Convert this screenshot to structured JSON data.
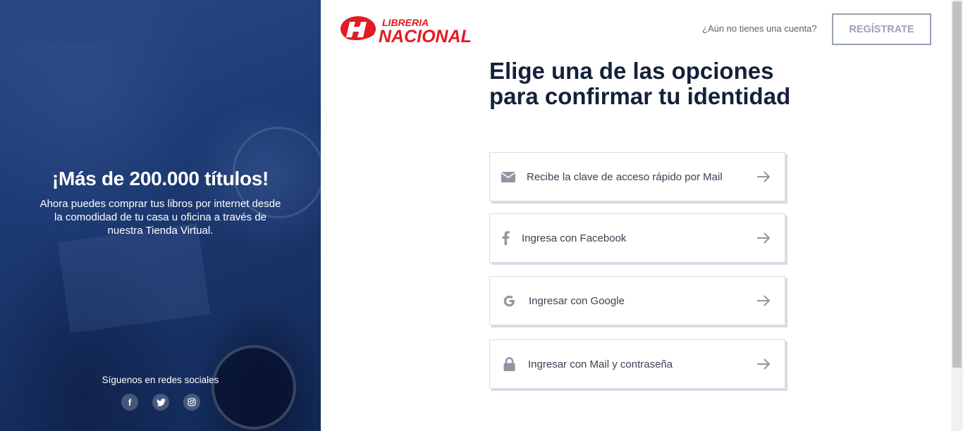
{
  "left_panel": {
    "headline": "¡Más de 200.000 títulos!",
    "description": "Ahora puedes comprar tus libros por internet desde la comodidad de tu casa u oficina a través de nuestra Tienda Virtual.",
    "social_label": "Síguenos en redes sociales",
    "social": [
      {
        "icon": "facebook-icon",
        "glyph": "f"
      },
      {
        "icon": "twitter-icon",
        "glyph": ""
      },
      {
        "icon": "instagram-icon",
        "glyph": ""
      }
    ],
    "colors": {
      "overlay": "#1d3a74"
    }
  },
  "header": {
    "logo_top": "LIBRERIA",
    "logo_bottom": "NACIONAL",
    "logo_color": "#e31b23",
    "question": "¿Aún no tienes una cuenta?",
    "register_label": "REGÍSTRATE"
  },
  "main": {
    "title": "Elige una de las opciones para confirmar tu identidad",
    "options": [
      {
        "label": "Recibe la clave de acceso rápido por Mail",
        "icon": "envelope-icon"
      },
      {
        "label": "Ingresa con Facebook",
        "icon": "facebook-icon"
      },
      {
        "label": "Ingresar con Google",
        "icon": "google-icon"
      },
      {
        "label": "Ingresar con Mail y contraseña",
        "icon": "lock-icon"
      }
    ]
  }
}
